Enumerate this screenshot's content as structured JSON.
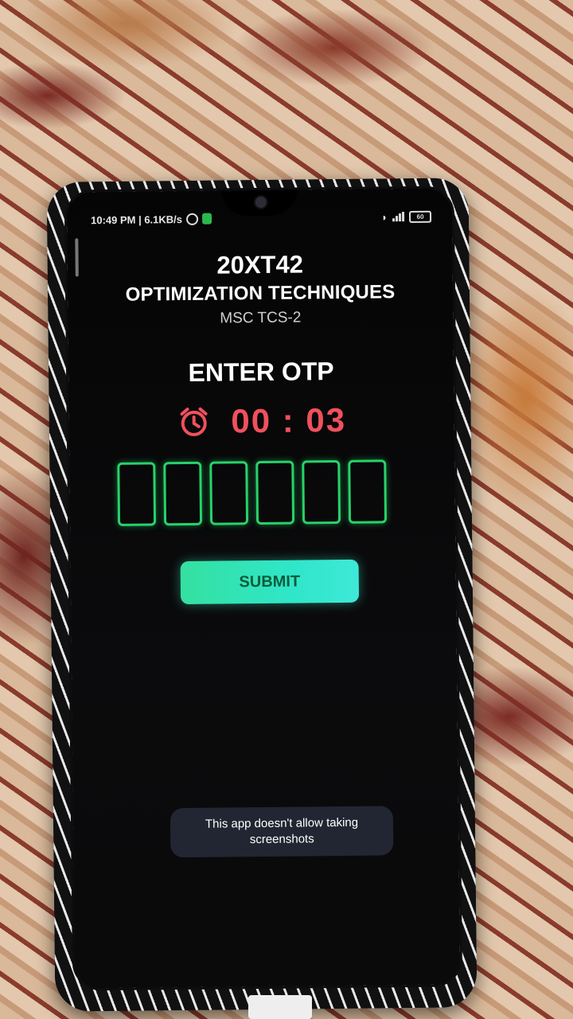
{
  "status_bar": {
    "time_speed": "10:49 PM | 6.1KB/s",
    "battery": "60"
  },
  "header": {
    "course_code": "20XT42",
    "course_title": "OPTIMIZATION TECHNIQUES",
    "program": "MSC TCS-2"
  },
  "otp": {
    "heading": "ENTER OTP",
    "timer": "00 : 03",
    "digits": [
      "",
      "",
      "",
      "",
      "",
      ""
    ]
  },
  "submit_label": "SUBMIT",
  "toast": "This app doesn't allow taking screenshots",
  "colors": {
    "accent_green": "#28d26a",
    "timer_red": "#f0505c",
    "button_gradient_start": "#35e0a0",
    "button_gradient_end": "#3ee8d8"
  },
  "icons": [
    "alarm-clock-icon",
    "wifi-icon",
    "signal-icon",
    "battery-icon"
  ]
}
